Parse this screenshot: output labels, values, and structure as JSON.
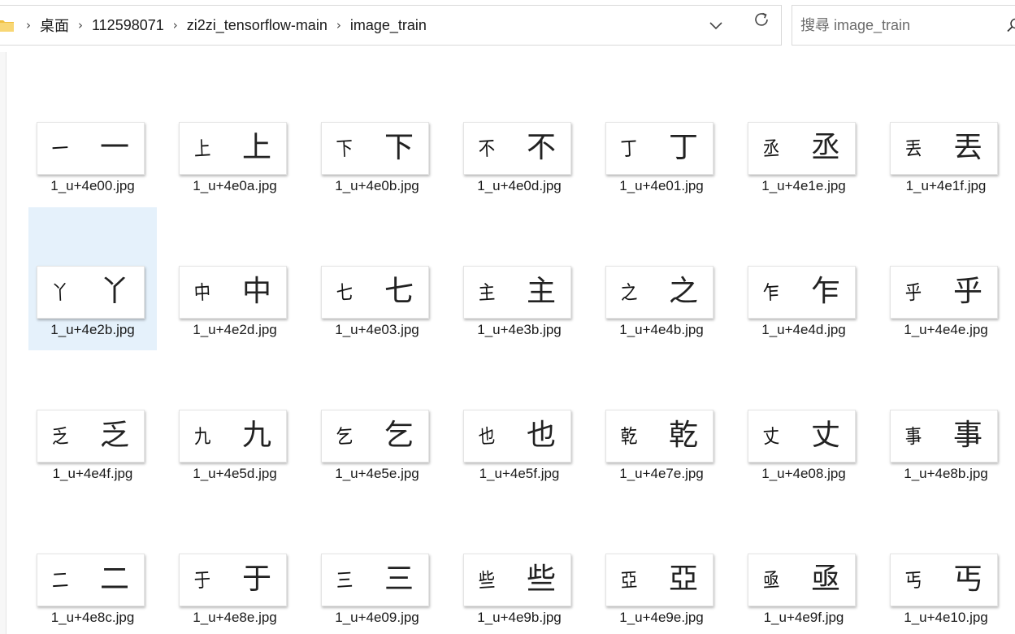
{
  "address_bar": {
    "breadcrumbs": [
      "桌面",
      "112598071",
      "zi2zi_tensorflow-main",
      "image_train"
    ]
  },
  "search": {
    "placeholder": "搜尋 image_train"
  },
  "icons": {
    "folder": "folder-icon",
    "separator": "chevron-right-icon",
    "dropdown": "chevron-down-icon",
    "refresh": "refresh-icon",
    "search": "search-icon"
  },
  "colors": {
    "selection": "#e5f1fb",
    "folder": "#f0c040"
  },
  "files": [
    {
      "name": "1_u+4e00.jpg",
      "char": "一",
      "selected": false
    },
    {
      "name": "1_u+4e0a.jpg",
      "char": "上",
      "selected": false
    },
    {
      "name": "1_u+4e0b.jpg",
      "char": "下",
      "selected": false
    },
    {
      "name": "1_u+4e0d.jpg",
      "char": "不",
      "selected": false
    },
    {
      "name": "1_u+4e01.jpg",
      "char": "丁",
      "selected": false
    },
    {
      "name": "1_u+4e1e.jpg",
      "char": "丞",
      "selected": false
    },
    {
      "name": "1_u+4e1f.jpg",
      "char": "丟",
      "selected": false
    },
    {
      "name": "1_u+4e2b.jpg",
      "char": "丫",
      "selected": true
    },
    {
      "name": "1_u+4e2d.jpg",
      "char": "中",
      "selected": false
    },
    {
      "name": "1_u+4e03.jpg",
      "char": "七",
      "selected": false
    },
    {
      "name": "1_u+4e3b.jpg",
      "char": "主",
      "selected": false
    },
    {
      "name": "1_u+4e4b.jpg",
      "char": "之",
      "selected": false
    },
    {
      "name": "1_u+4e4d.jpg",
      "char": "乍",
      "selected": false
    },
    {
      "name": "1_u+4e4e.jpg",
      "char": "乎",
      "selected": false
    },
    {
      "name": "1_u+4e4f.jpg",
      "char": "乏",
      "selected": false
    },
    {
      "name": "1_u+4e5d.jpg",
      "char": "九",
      "selected": false
    },
    {
      "name": "1_u+4e5e.jpg",
      "char": "乞",
      "selected": false
    },
    {
      "name": "1_u+4e5f.jpg",
      "char": "也",
      "selected": false
    },
    {
      "name": "1_u+4e7e.jpg",
      "char": "乾",
      "selected": false
    },
    {
      "name": "1_u+4e08.jpg",
      "char": "丈",
      "selected": false
    },
    {
      "name": "1_u+4e8b.jpg",
      "char": "事",
      "selected": false
    },
    {
      "name": "1_u+4e8c.jpg",
      "char": "二",
      "selected": false
    },
    {
      "name": "1_u+4e8e.jpg",
      "char": "于",
      "selected": false
    },
    {
      "name": "1_u+4e09.jpg",
      "char": "三",
      "selected": false
    },
    {
      "name": "1_u+4e9b.jpg",
      "char": "些",
      "selected": false
    },
    {
      "name": "1_u+4e9e.jpg",
      "char": "亞",
      "selected": false
    },
    {
      "name": "1_u+4e9f.jpg",
      "char": "亟",
      "selected": false
    },
    {
      "name": "1_u+4e10.jpg",
      "char": "丐",
      "selected": false
    }
  ]
}
